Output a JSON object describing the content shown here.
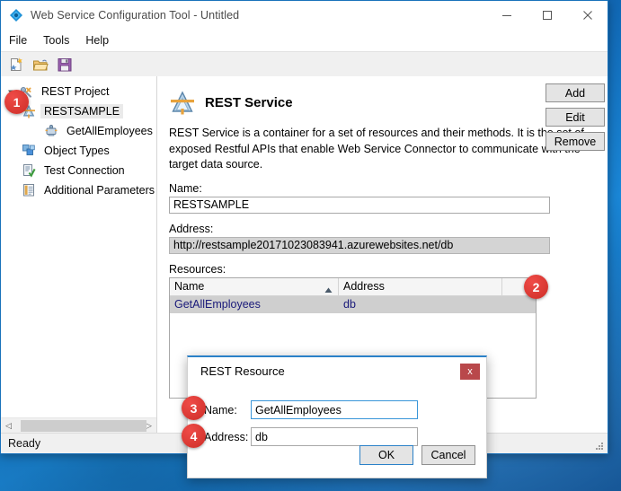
{
  "window": {
    "title": "Web Service Configuration Tool - Untitled",
    "app_icon": "diamond-icon",
    "minimize_label": "Minimize",
    "maximize_label": "Maximize",
    "close_label": "Close"
  },
  "menubar": {
    "items": [
      {
        "label": "File"
      },
      {
        "label": "Tools"
      },
      {
        "label": "Help"
      }
    ]
  },
  "toolbar": {
    "buttons": [
      {
        "name": "new-file-icon",
        "tooltip": "New"
      },
      {
        "name": "open-folder-icon",
        "tooltip": "Open"
      },
      {
        "name": "save-disk-icon",
        "tooltip": "Save"
      }
    ]
  },
  "tree": {
    "items": [
      {
        "label": "REST Project",
        "icon": "rest-project-icon",
        "indent": "root",
        "expanded": true,
        "selected": false
      },
      {
        "label": "RESTSAMPLE",
        "icon": "rest-service-icon",
        "indent": "1",
        "expanded": false,
        "selected": true
      },
      {
        "label": "GetAllEmployees",
        "icon": "rest-resource-icon",
        "indent": "2",
        "expanded": false,
        "selected": false
      },
      {
        "label": "Object Types",
        "icon": "object-types-icon",
        "indent": "1",
        "expanded": false,
        "selected": false
      },
      {
        "label": "Test Connection",
        "icon": "test-connection-icon",
        "indent": "1",
        "expanded": false,
        "selected": false
      },
      {
        "label": "Additional Parameters",
        "icon": "additional-parameters-icon",
        "indent": "1",
        "expanded": false,
        "selected": false
      }
    ]
  },
  "panel": {
    "icon": "rest-service-icon",
    "title": "REST Service",
    "description": "REST Service is a container for a set of resources and their methods. It is the set of exposed Restful APIs that enable Web Service Connector to communicate with the target data source.",
    "name_label": "Name:",
    "name_value": "RESTSAMPLE",
    "address_label": "Address:",
    "address_value": "http://restsample20171023083941.azurewebsites.net/db",
    "resources_label": "Resources:"
  },
  "grid": {
    "columns": [
      {
        "label": "Name",
        "sorted": "asc"
      },
      {
        "label": "Address",
        "sorted": "none"
      }
    ],
    "rows": [
      {
        "name": "GetAllEmployees",
        "address": "db",
        "selected": true
      }
    ]
  },
  "side_buttons": [
    {
      "label": "Add"
    },
    {
      "label": "Edit"
    },
    {
      "label": "Remove"
    }
  ],
  "statusbar": {
    "text": "Ready"
  },
  "dialog": {
    "title": "REST Resource",
    "close_label": "x",
    "name_label": "Name:",
    "name_value": "GetAllEmployees",
    "address_label": "Address:",
    "address_value": "db",
    "ok_label": "OK",
    "cancel_label": "Cancel"
  },
  "callouts": [
    {
      "number": "1"
    },
    {
      "number": "2"
    },
    {
      "number": "3"
    },
    {
      "number": "4"
    }
  ],
  "colors": {
    "accent": "#2b81c8",
    "badge": "#d5352f",
    "close_button": "#b9484b",
    "selection": "#cfcfcf"
  }
}
